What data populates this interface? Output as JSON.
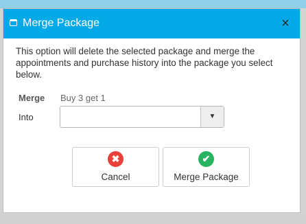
{
  "dialog": {
    "title": "Merge Package",
    "close_glyph": "×",
    "description": "This option will delete the selected package and merge the appointments and purchase history into the package you select below.",
    "merge_label": "Merge",
    "merge_value": "Buy 3 get 1",
    "into_label": "Into",
    "into_select": {
      "value": "",
      "arrow_glyph": "▼"
    },
    "buttons": {
      "cancel": {
        "label": "Cancel",
        "icon": "x-circle-icon",
        "icon_glyph": "✖",
        "color": "#e9413a"
      },
      "merge": {
        "label": "Merge Package",
        "icon": "check-circle-icon",
        "icon_glyph": "✔",
        "color": "#27b35f"
      }
    },
    "colors": {
      "titlebar": "#04a9e8"
    }
  }
}
